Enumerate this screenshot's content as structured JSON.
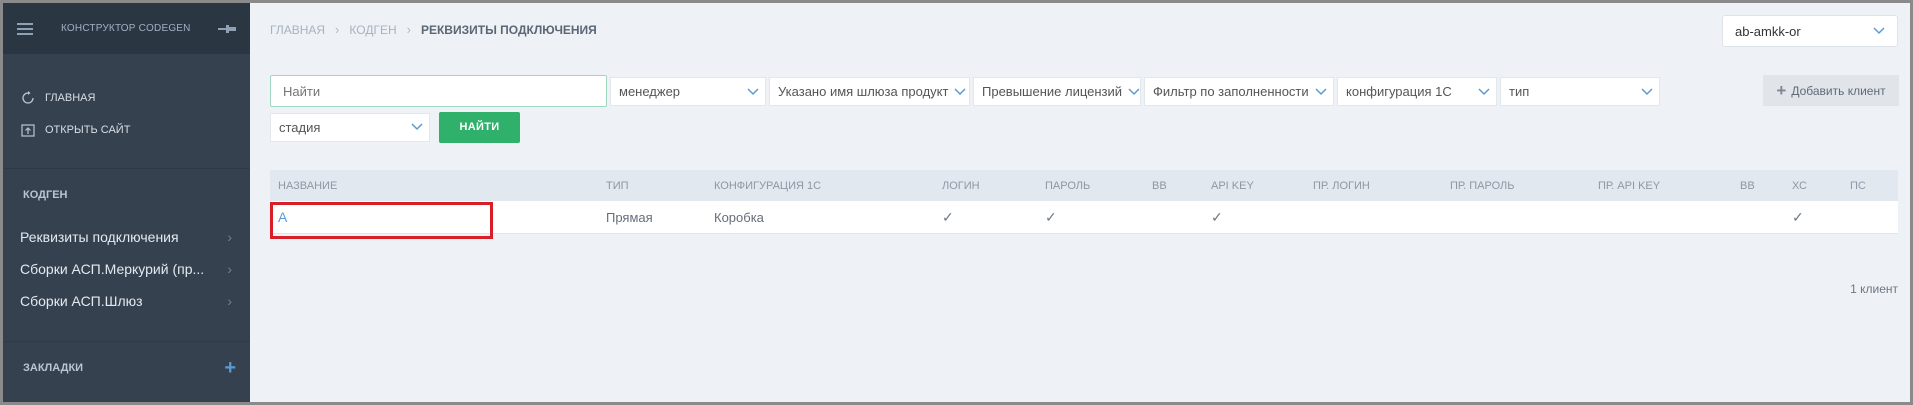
{
  "sidebar": {
    "brand": "КОНСТРУКТОР CODEGEN",
    "links": [
      {
        "label": "ГЛАВНАЯ",
        "icon": "refresh-icon"
      },
      {
        "label": "ОТКРЫТЬ САЙТ",
        "icon": "upload-icon"
      }
    ],
    "section_title": "КОДГЕН",
    "items": [
      {
        "label": "Реквизиты подключения"
      },
      {
        "label": "Сборки АСП.Меркурий (пр..."
      },
      {
        "label": "Сборки АСП.Шлюз"
      }
    ],
    "bookmarks_title": "ЗАКЛАДКИ"
  },
  "header": {
    "breadcrumb": [
      "ГЛАВНАЯ",
      "КОДГЕН",
      "РЕКВИЗИТЫ ПОДКЛЮЧЕНИЯ"
    ],
    "org": "ab-amkk-or"
  },
  "filters": {
    "search_placeholder": "Найти",
    "selects": [
      "менеджер",
      "Указано имя шлюза продукт",
      "Превышение лицензий",
      "Фильтр по заполненности",
      "конфигурация 1С",
      "тип"
    ],
    "stage": "стадия",
    "find_label": "НАЙТИ",
    "add_client_label": "Добавить клиент"
  },
  "table": {
    "columns": [
      "НАЗВАНИЕ",
      "ТИП",
      "КОНФИГУРАЦИЯ 1С",
      "ЛОГИН",
      "ПАРОЛЬ",
      "ВВ",
      "API KEY",
      "ПР. ЛОГИН",
      "ПР. ПАРОЛЬ",
      "ПР. API KEY",
      "ВВ",
      "ХС",
      "ПС"
    ],
    "rows": [
      {
        "name": "А",
        "type": "Прямая",
        "config": "Коробка",
        "login": "✓",
        "password": "✓",
        "vv": "",
        "api_key": "✓",
        "pr_login": "",
        "pr_password": "",
        "pr_api_key": "",
        "vv2": "",
        "hs": "✓",
        "ps": ""
      }
    ]
  },
  "footer": {
    "count": "1 клиент"
  },
  "colors": {
    "accent_green": "#2fb06b",
    "link_blue": "#5b9bd5",
    "sidebar_bg": "#364150",
    "highlight_red": "#d81e27"
  }
}
